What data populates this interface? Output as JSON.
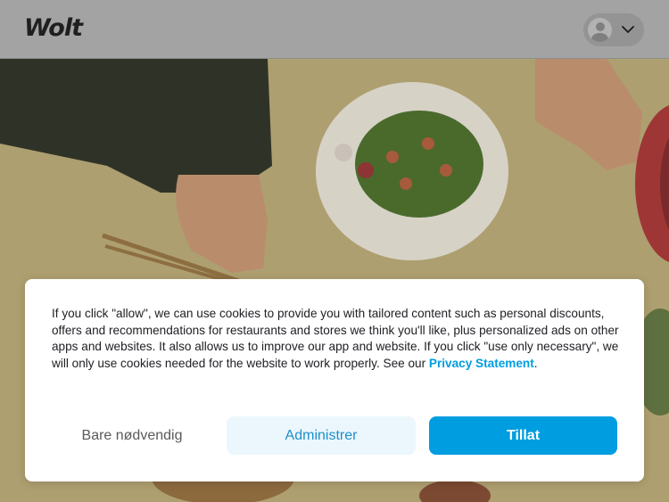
{
  "header": {
    "logo_text": "Wolt",
    "profile_icon": "user-avatar-icon",
    "menu_icon": "chevron-down-icon"
  },
  "hero": {
    "image": "food-bowls-photo"
  },
  "cookie_dialog": {
    "text_before_link": "If you click \"allow\", we can use cookies to provide you with tailored content such as personal discounts, offers and recommendations for restaurants and stores we think you'll like, plus personalized ads on other apps and websites. It also allows us to improve our app and website. If you click \"use only necessary\", we will only use cookies needed for the website to work properly. See our ",
    "link_label": "Privacy Statement",
    "text_after_link": ".",
    "buttons": {
      "necessary": "Bare nødvendig",
      "manage": "Administrer",
      "allow": "Tillat"
    }
  },
  "colors": {
    "accent": "#009de0",
    "accent_light": "#ebf7fd",
    "text": "#202125"
  }
}
